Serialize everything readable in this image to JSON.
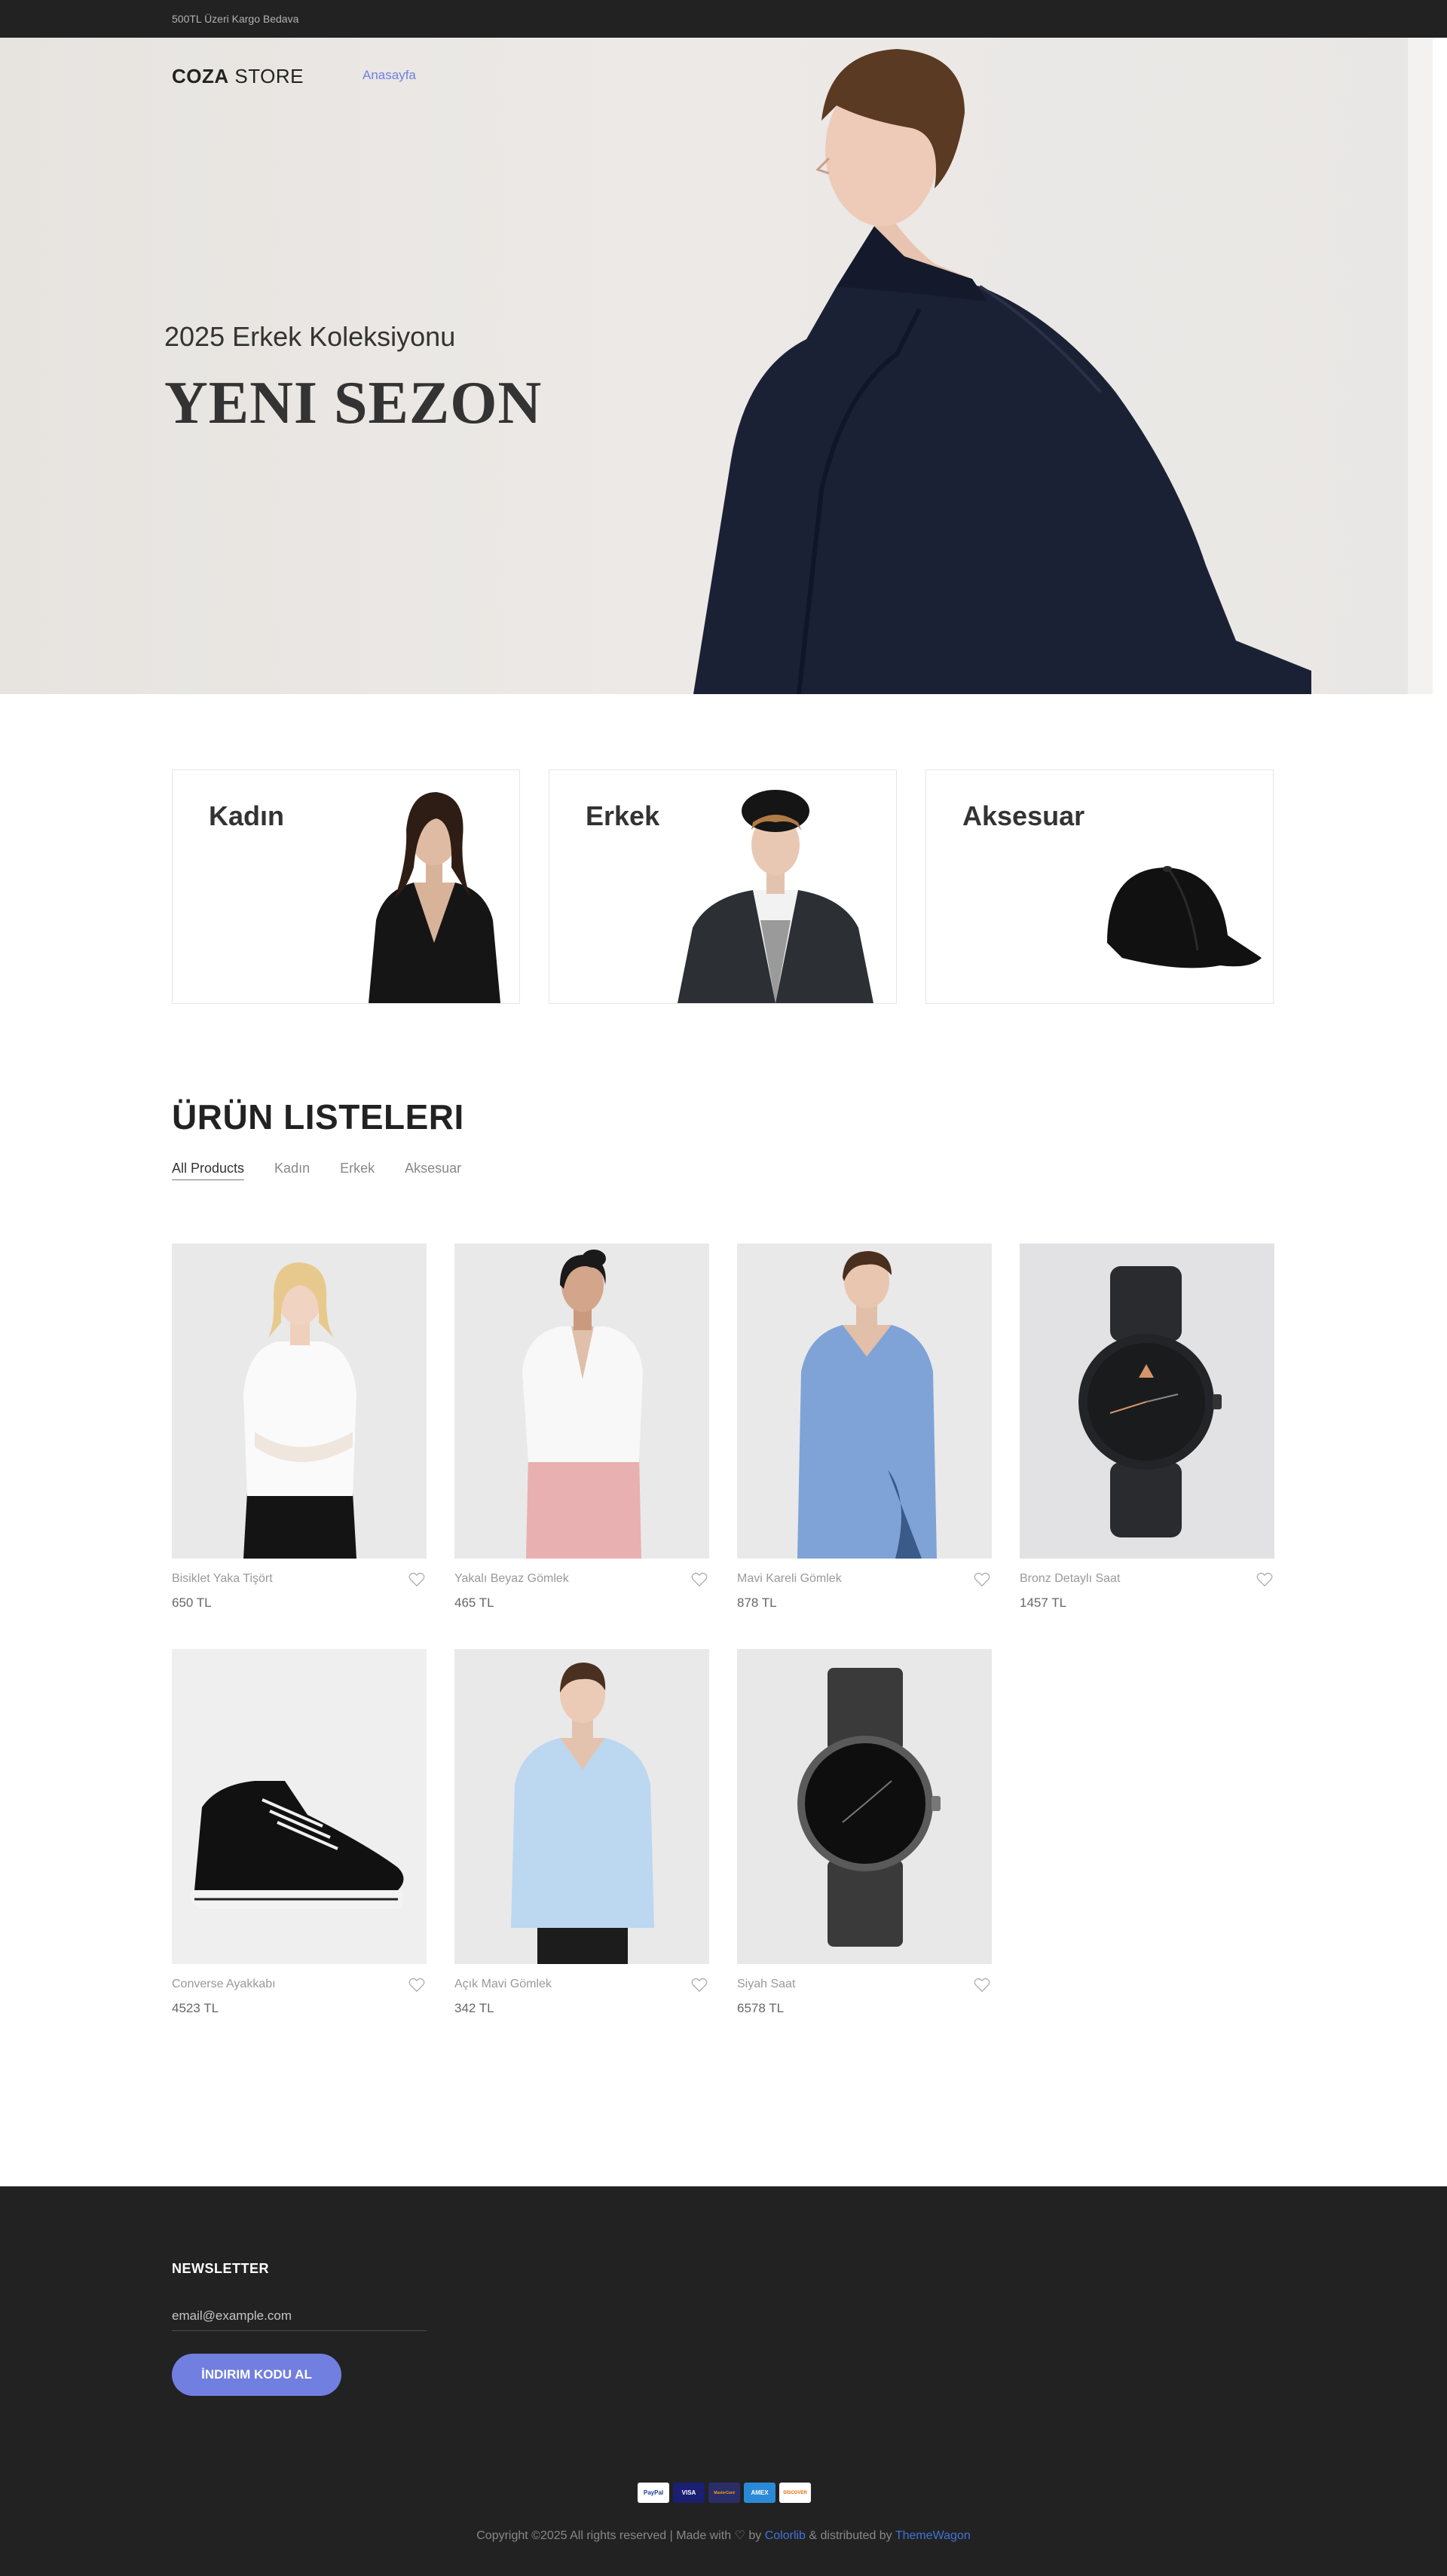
{
  "topbar": {
    "note": "500TL Üzeri Kargo Bedava"
  },
  "header": {
    "logo_bold": "COZA",
    "logo_light": " STORE",
    "nav_home": "Anasayfa"
  },
  "hero": {
    "subtitle": "2025 Erkek Koleksiyonu",
    "title": "YENI SEZON"
  },
  "banners": [
    {
      "label": "Kadın"
    },
    {
      "label": "Erkek"
    },
    {
      "label": "Aksesuar"
    }
  ],
  "products": {
    "title": "ÜRÜN LISTELERI",
    "filters": [
      "All Products",
      "Kadın",
      "Erkek",
      "Aksesuar"
    ],
    "active_filter": "All Products",
    "items": [
      {
        "name": "Bisiklet Yaka Tişört",
        "price": "650 TL"
      },
      {
        "name": "Yakalı Beyaz Gömlek",
        "price": "465 TL"
      },
      {
        "name": "Mavi Kareli Gömlek",
        "price": "878 TL"
      },
      {
        "name": "Bronz Detaylı Saat",
        "price": "1457 TL"
      },
      {
        "name": "Converse Ayakkabı",
        "price": "4523 TL"
      },
      {
        "name": "Açık Mavi Gömlek",
        "price": "342 TL"
      },
      {
        "name": "Siyah Saat",
        "price": "6578 TL"
      }
    ]
  },
  "footer": {
    "newsletter_title": "NEWSLETTER",
    "email_placeholder": "email@example.com",
    "button_label": "İNDIRIM KODU AL",
    "payments": [
      "PayPal",
      "VISA",
      "MasterCard",
      "AMEX",
      "DISCOVER"
    ],
    "copyright_prefix": "Copyright ©2025 All rights reserved | Made with ♡ by ",
    "colorlib": "Colorlib",
    "copyright_mid": " & distributed by ",
    "themewagon": "ThemeWagon"
  },
  "colors": {
    "accent": "#717fe0",
    "dark": "#222222",
    "link": "#4272d7"
  }
}
